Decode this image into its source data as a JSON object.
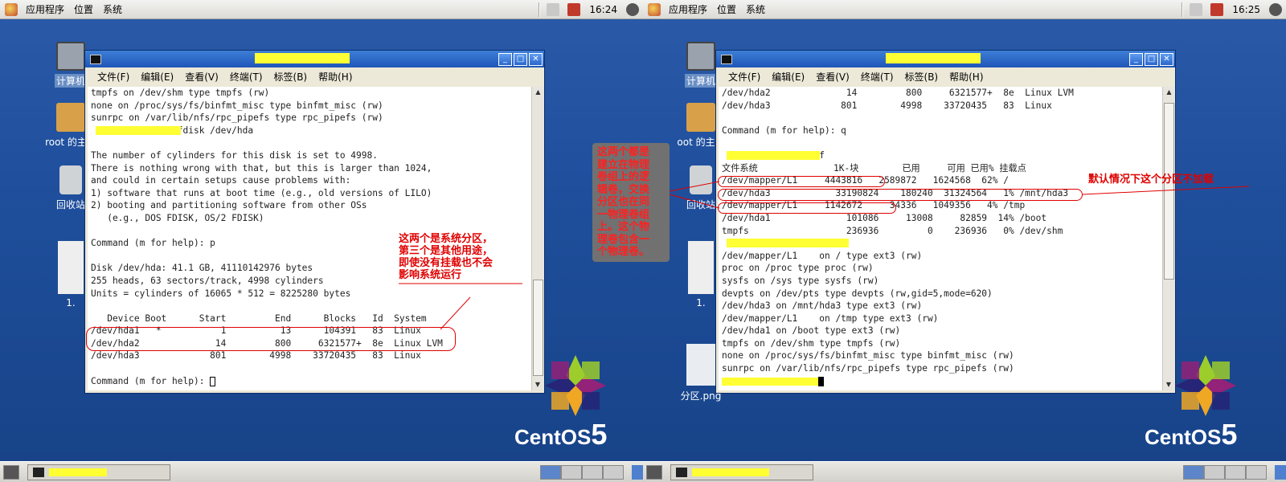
{
  "left": {
    "panel": {
      "menus": [
        "应用程序",
        "位置",
        "系统"
      ],
      "clock": "16:24"
    },
    "desktop_icons": [
      "计算机",
      "root 的主文",
      "回收站",
      "1."
    ],
    "window": {
      "menu": [
        "文件(F)",
        "编辑(E)",
        "查看(V)",
        "终端(T)",
        "标签(B)",
        "帮助(H)"
      ],
      "lines": [
        "tmpfs on /dev/shm type tmpfs (rw)",
        "none on /proc/sys/fs/binfmt_misc type binfmt_misc (rw)",
        "sunrpc on /var/lib/nfs/rpc_pipefs type rpc_pipefs (rw)",
        "                fdisk /dev/hda",
        "",
        "The number of cylinders for this disk is set to 4998.",
        "There is nothing wrong with that, but this is larger than 1024,",
        "and could in certain setups cause problems with:",
        "1) software that runs at boot time (e.g., old versions of LILO)",
        "2) booting and partitioning software from other OSs",
        "   (e.g., DOS FDISK, OS/2 FDISK)",
        "",
        "Command (m for help): p",
        "",
        "Disk /dev/hda: 41.1 GB, 41110142976 bytes",
        "255 heads, 63 sectors/track, 4998 cylinders",
        "Units = cylinders of 16065 * 512 = 8225280 bytes",
        "",
        "   Device Boot      Start         End      Blocks   Id  System",
        "/dev/hda1   *           1          13      104391   83  Linux",
        "/dev/hda2              14         800     6321577+  8e  Linux LVM",
        "/dev/hda3             801        4998    33720435   83  Linux",
        "",
        "Command (m for help): "
      ]
    },
    "annotation": "这两个是系统分区，\n第三个是其他用途，\n即使没有挂载也不会\n影响系统运行"
  },
  "middle_annotation": "这两个都是\n建立在物理\n卷组上的逻\n辑卷，交换\n分区也在同\n一物理卷组\n上。这个物\n理卷包含一\n个物理卷。",
  "right": {
    "panel": {
      "menus": [
        "应用程序",
        "位置",
        "系统"
      ],
      "clock": "16:25"
    },
    "desktop_icons": [
      "计算机",
      "oot 的主文",
      "回收站",
      "1.",
      "分区.png"
    ],
    "window": {
      "menu": [
        "文件(F)",
        "编辑(E)",
        "查看(V)",
        "终端(T)",
        "标签(B)",
        "帮助(H)"
      ],
      "lines": [
        "/dev/hda2              14         800     6321577+  8e  Linux LVM",
        "/dev/hda3             801        4998    33720435   83  Linux",
        "",
        "Command (m for help): q",
        "",
        "                 df",
        "文件系统              1K-块        已用     可用 已用% 挂载点",
        "/dev/mapper/L1     4443816   2589872   1624568  62% /",
        "/dev/hda3            33190824    180240  31324564   1% /mnt/hda3",
        "/dev/mapper/L1     1142672     34336   1049356   4% /tmp",
        "/dev/hda1              101086     13008     82859  14% /boot",
        "tmpfs                  236936         0    236936   0% /dev/shm",
        "",
        "/dev/mapper/L1    on / type ext3 (rw)",
        "proc on /proc type proc (rw)",
        "sysfs on /sys type sysfs (rw)",
        "devpts on /dev/pts type devpts (rw,gid=5,mode=620)",
        "/dev/hda3 on /mnt/hda3 type ext3 (rw)",
        "/dev/mapper/L1    on /tmp type ext3 (rw)",
        "/dev/hda1 on /boot type ext3 (rw)",
        "tmpfs on /dev/shm type tmpfs (rw)",
        "none on /proc/sys/fs/binfmt_misc type binfmt_misc (rw)",
        "sunrpc on /var/lib/nfs/rpc_pipefs type rpc_pipefs (rw)",
        ""
      ]
    },
    "annotation": "默认情况下这个分区不加载"
  },
  "logo": {
    "text": "CentOS",
    "number": "5"
  },
  "colors": {
    "accent_red": "#e00000",
    "redaction": "#ffff33",
    "desktop": "#1f4f9c"
  }
}
